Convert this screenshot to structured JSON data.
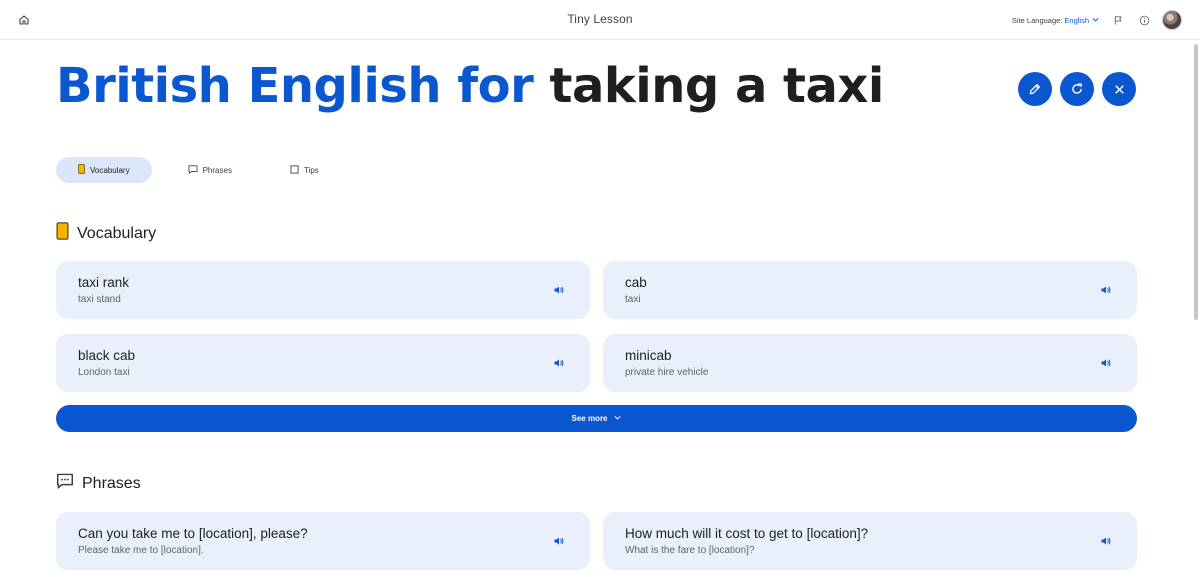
{
  "app": {
    "title": "Tiny Lesson",
    "site_language_label": "Site Language:",
    "site_language_value": "English"
  },
  "headline": {
    "highlight": "British English for",
    "topic": "taking a taxi"
  },
  "tabs": [
    {
      "label": "Vocabulary",
      "active": true,
      "icon": "book-icon"
    },
    {
      "label": "Phrases",
      "active": false,
      "icon": "chat-icon"
    },
    {
      "label": "Tips",
      "active": false,
      "icon": "square-icon"
    }
  ],
  "sections": {
    "vocabulary": {
      "title": "Vocabulary",
      "icon": "book-icon",
      "items": [
        {
          "term": "taxi rank",
          "translation": "taxi stand"
        },
        {
          "term": "cab",
          "translation": "taxi"
        },
        {
          "term": "black cab",
          "translation": "London taxi"
        },
        {
          "term": "minicab",
          "translation": "private hire vehicle"
        }
      ],
      "see_more": "See more"
    },
    "phrases": {
      "title": "Phrases",
      "icon": "chat-icon",
      "items": [
        {
          "term": "Can you take me to [location], please?",
          "translation": "Please take me to [location]."
        },
        {
          "term": "How much will it cost to get to [location]?",
          "translation": "What is the fare to [location]?"
        }
      ]
    }
  },
  "colors": {
    "accent": "#0b57d0",
    "card_bg": "#e9f0fc",
    "tab_active_bg": "#dbe6fb",
    "book_icon": "#f4b400"
  }
}
